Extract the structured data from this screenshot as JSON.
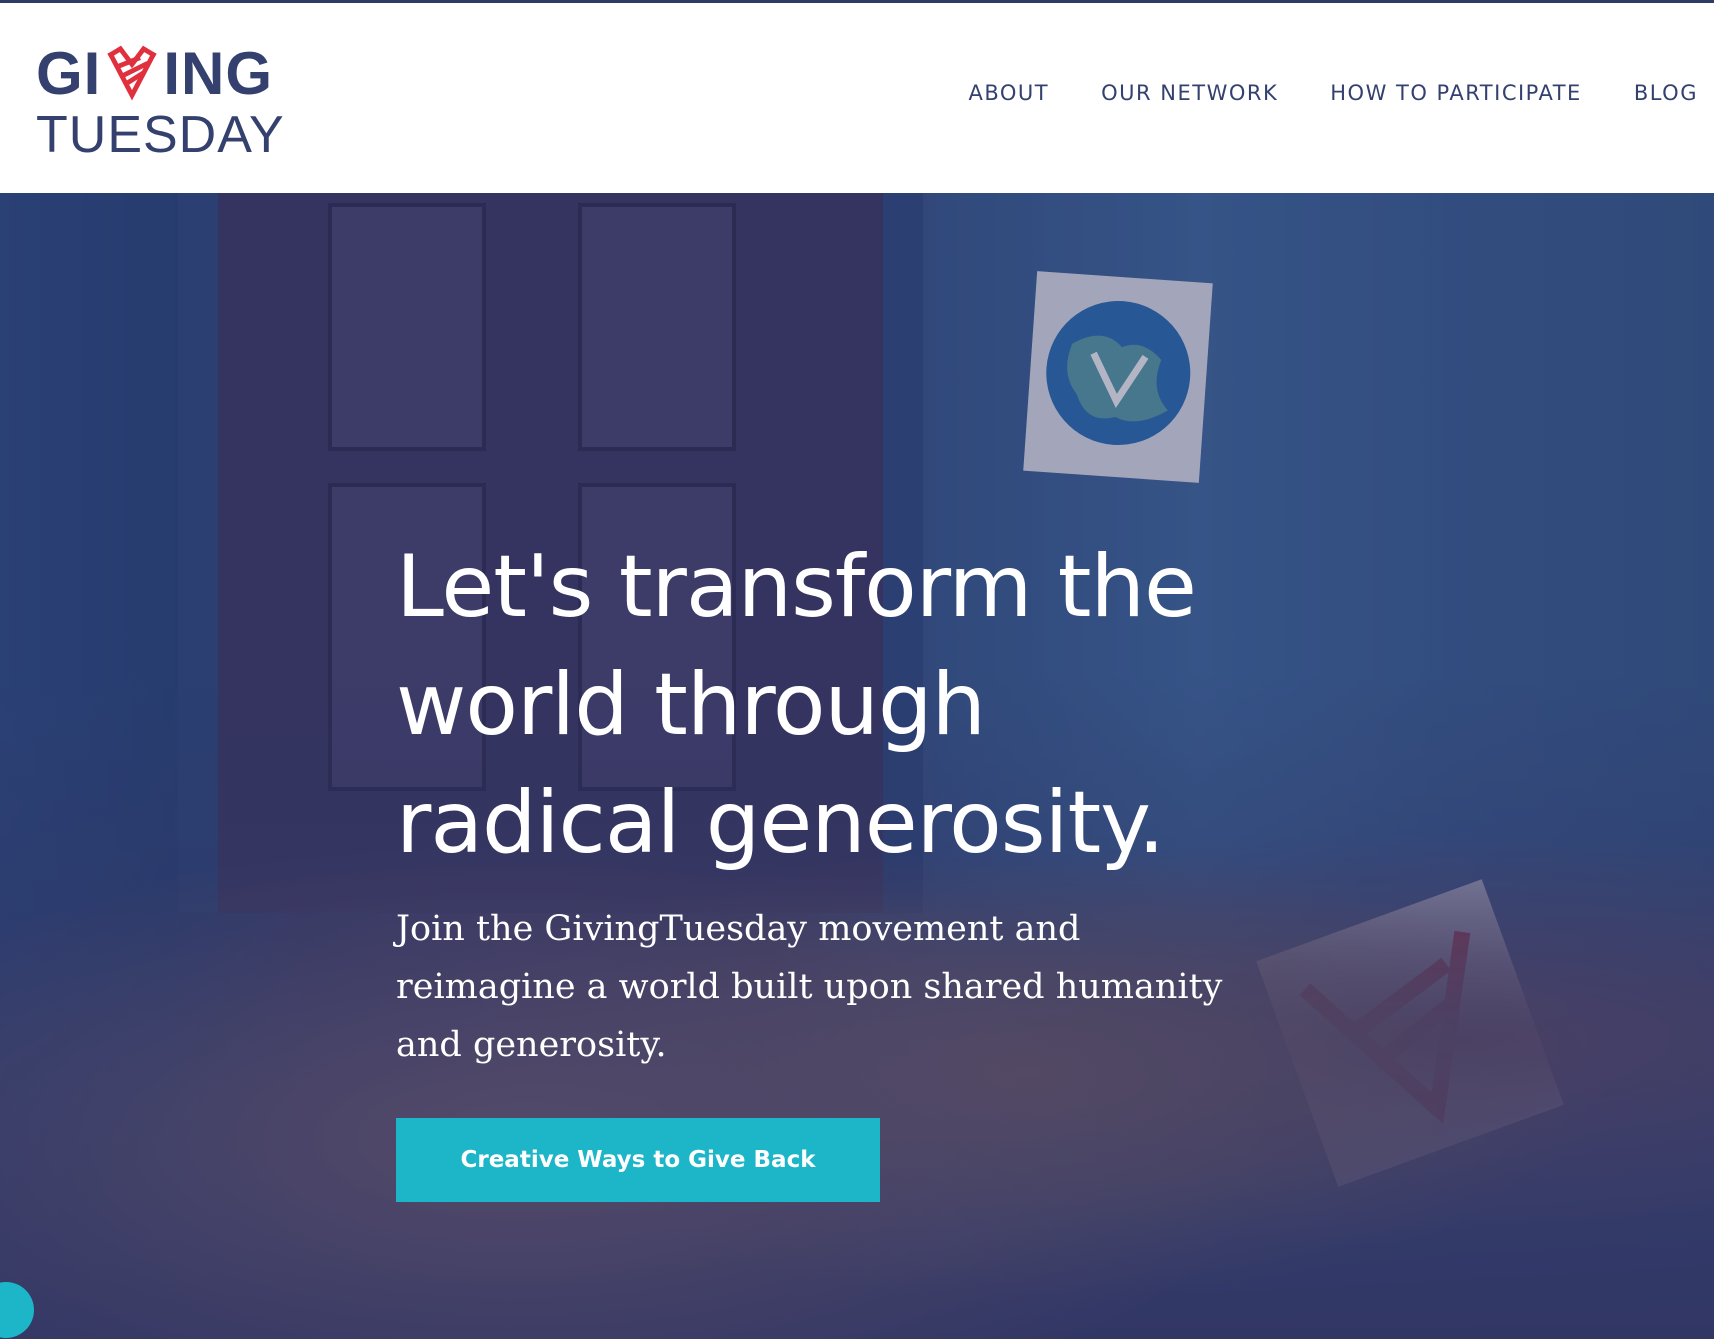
{
  "header": {
    "logo_line1_a": "GI",
    "logo_line1_b": "ING",
    "logo_line2": "TUESDAY"
  },
  "nav": {
    "items": [
      {
        "label": "ABOUT"
      },
      {
        "label": "OUR NETWORK"
      },
      {
        "label": "HOW TO PARTICIPATE"
      },
      {
        "label": "BLOG"
      }
    ]
  },
  "hero": {
    "title": "Let's transform the world through radical generosity.",
    "subtitle": "Join the GivingTuesday movement and reimagine a world built upon shared humanity and generosity.",
    "cta_label": "Creative Ways to Give Back"
  },
  "colors": {
    "brand_navy": "#34416f",
    "brand_red": "#e0303e",
    "cta_teal": "#1cb6c8"
  },
  "icons": {
    "logo_heart": "giving-heart-icon",
    "chat": "chat-widget-icon"
  }
}
